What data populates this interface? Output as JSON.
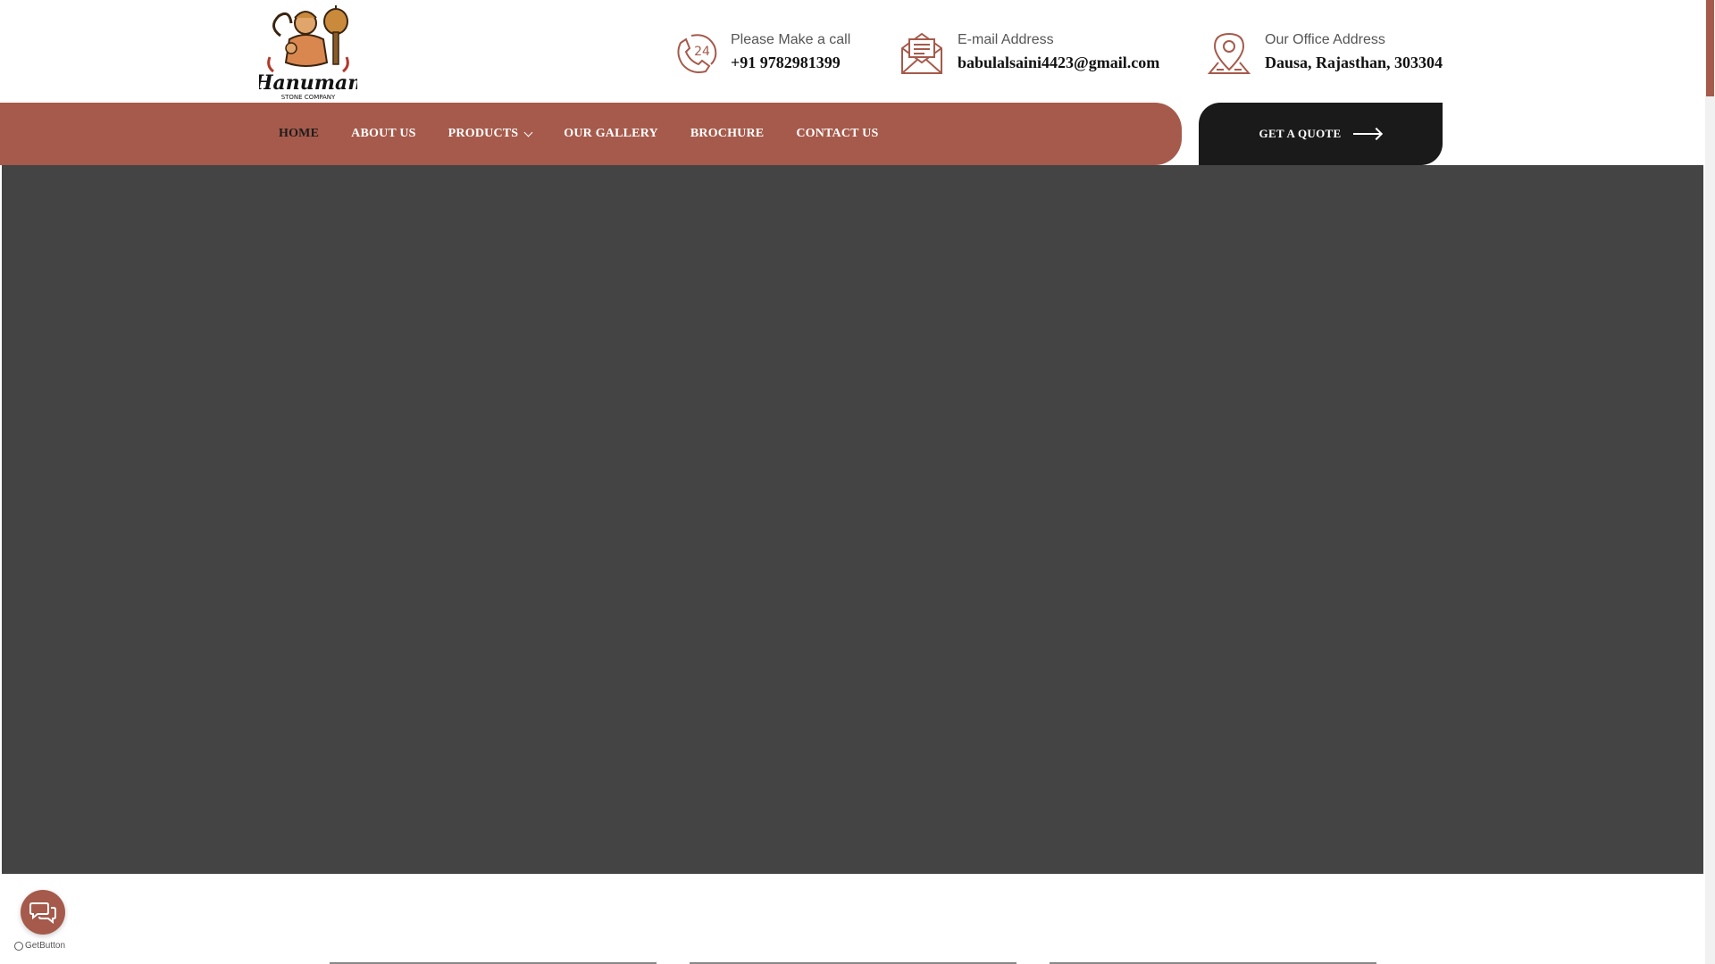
{
  "brand": {
    "logo_alt": "Hanuman Stone Company",
    "logo_text": "Hanuman",
    "logo_subtext": "STONE COMPANY"
  },
  "contact": {
    "call_label": "Please Make a call",
    "call_value": "+91 9782981399",
    "email_label": "E-mail Address",
    "email_value": "babulalsaini4423@gmail.com",
    "address_label": "Our Office Address",
    "address_value": "Dausa, Rajasthan, 303304"
  },
  "nav": {
    "items": [
      {
        "label": "HOME"
      },
      {
        "label": "ABOUT US"
      },
      {
        "label": "PRODUCTS"
      },
      {
        "label": "OUR GALLERY"
      },
      {
        "label": "BROCHURE"
      },
      {
        "label": "CONTACT US"
      }
    ],
    "quote_label": "GET A QUOTE"
  },
  "widget": {
    "getbutton_label": "GetButton"
  },
  "colors": {
    "accent": "#a65a4b",
    "dark": "#1a1a1a",
    "hero_bg": "#444444"
  }
}
